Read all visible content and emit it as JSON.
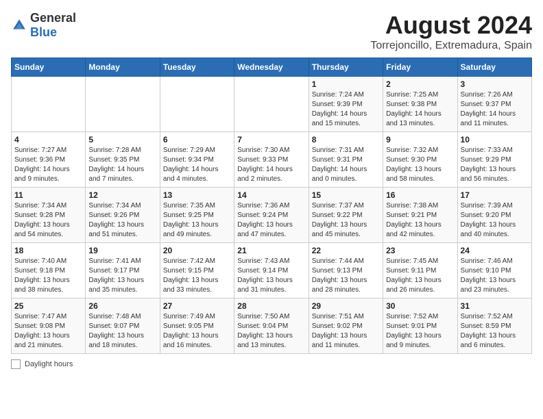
{
  "logo": {
    "general": "General",
    "blue": "Blue"
  },
  "title": "August 2024",
  "subtitle": "Torrejoncillo, Extremadura, Spain",
  "days_of_week": [
    "Sunday",
    "Monday",
    "Tuesday",
    "Wednesday",
    "Thursday",
    "Friday",
    "Saturday"
  ],
  "weeks": [
    [
      {
        "day": "",
        "info": ""
      },
      {
        "day": "",
        "info": ""
      },
      {
        "day": "",
        "info": ""
      },
      {
        "day": "",
        "info": ""
      },
      {
        "day": "1",
        "info": "Sunrise: 7:24 AM\nSunset: 9:39 PM\nDaylight: 14 hours\nand 15 minutes."
      },
      {
        "day": "2",
        "info": "Sunrise: 7:25 AM\nSunset: 9:38 PM\nDaylight: 14 hours\nand 13 minutes."
      },
      {
        "day": "3",
        "info": "Sunrise: 7:26 AM\nSunset: 9:37 PM\nDaylight: 14 hours\nand 11 minutes."
      }
    ],
    [
      {
        "day": "4",
        "info": "Sunrise: 7:27 AM\nSunset: 9:36 PM\nDaylight: 14 hours\nand 9 minutes."
      },
      {
        "day": "5",
        "info": "Sunrise: 7:28 AM\nSunset: 9:35 PM\nDaylight: 14 hours\nand 7 minutes."
      },
      {
        "day": "6",
        "info": "Sunrise: 7:29 AM\nSunset: 9:34 PM\nDaylight: 14 hours\nand 4 minutes."
      },
      {
        "day": "7",
        "info": "Sunrise: 7:30 AM\nSunset: 9:33 PM\nDaylight: 14 hours\nand 2 minutes."
      },
      {
        "day": "8",
        "info": "Sunrise: 7:31 AM\nSunset: 9:31 PM\nDaylight: 14 hours\nand 0 minutes."
      },
      {
        "day": "9",
        "info": "Sunrise: 7:32 AM\nSunset: 9:30 PM\nDaylight: 13 hours\nand 58 minutes."
      },
      {
        "day": "10",
        "info": "Sunrise: 7:33 AM\nSunset: 9:29 PM\nDaylight: 13 hours\nand 56 minutes."
      }
    ],
    [
      {
        "day": "11",
        "info": "Sunrise: 7:34 AM\nSunset: 9:28 PM\nDaylight: 13 hours\nand 54 minutes."
      },
      {
        "day": "12",
        "info": "Sunrise: 7:34 AM\nSunset: 9:26 PM\nDaylight: 13 hours\nand 51 minutes."
      },
      {
        "day": "13",
        "info": "Sunrise: 7:35 AM\nSunset: 9:25 PM\nDaylight: 13 hours\nand 49 minutes."
      },
      {
        "day": "14",
        "info": "Sunrise: 7:36 AM\nSunset: 9:24 PM\nDaylight: 13 hours\nand 47 minutes."
      },
      {
        "day": "15",
        "info": "Sunrise: 7:37 AM\nSunset: 9:22 PM\nDaylight: 13 hours\nand 45 minutes."
      },
      {
        "day": "16",
        "info": "Sunrise: 7:38 AM\nSunset: 9:21 PM\nDaylight: 13 hours\nand 42 minutes."
      },
      {
        "day": "17",
        "info": "Sunrise: 7:39 AM\nSunset: 9:20 PM\nDaylight: 13 hours\nand 40 minutes."
      }
    ],
    [
      {
        "day": "18",
        "info": "Sunrise: 7:40 AM\nSunset: 9:18 PM\nDaylight: 13 hours\nand 38 minutes."
      },
      {
        "day": "19",
        "info": "Sunrise: 7:41 AM\nSunset: 9:17 PM\nDaylight: 13 hours\nand 35 minutes."
      },
      {
        "day": "20",
        "info": "Sunrise: 7:42 AM\nSunset: 9:15 PM\nDaylight: 13 hours\nand 33 minutes."
      },
      {
        "day": "21",
        "info": "Sunrise: 7:43 AM\nSunset: 9:14 PM\nDaylight: 13 hours\nand 31 minutes."
      },
      {
        "day": "22",
        "info": "Sunrise: 7:44 AM\nSunset: 9:13 PM\nDaylight: 13 hours\nand 28 minutes."
      },
      {
        "day": "23",
        "info": "Sunrise: 7:45 AM\nSunset: 9:11 PM\nDaylight: 13 hours\nand 26 minutes."
      },
      {
        "day": "24",
        "info": "Sunrise: 7:46 AM\nSunset: 9:10 PM\nDaylight: 13 hours\nand 23 minutes."
      }
    ],
    [
      {
        "day": "25",
        "info": "Sunrise: 7:47 AM\nSunset: 9:08 PM\nDaylight: 13 hours\nand 21 minutes."
      },
      {
        "day": "26",
        "info": "Sunrise: 7:48 AM\nSunset: 9:07 PM\nDaylight: 13 hours\nand 18 minutes."
      },
      {
        "day": "27",
        "info": "Sunrise: 7:49 AM\nSunset: 9:05 PM\nDaylight: 13 hours\nand 16 minutes."
      },
      {
        "day": "28",
        "info": "Sunrise: 7:50 AM\nSunset: 9:04 PM\nDaylight: 13 hours\nand 13 minutes."
      },
      {
        "day": "29",
        "info": "Sunrise: 7:51 AM\nSunset: 9:02 PM\nDaylight: 13 hours\nand 11 minutes."
      },
      {
        "day": "30",
        "info": "Sunrise: 7:52 AM\nSunset: 9:01 PM\nDaylight: 13 hours\nand 9 minutes."
      },
      {
        "day": "31",
        "info": "Sunrise: 7:52 AM\nSunset: 8:59 PM\nDaylight: 13 hours\nand 6 minutes."
      }
    ]
  ],
  "legend": {
    "daylight_label": "Daylight hours"
  }
}
